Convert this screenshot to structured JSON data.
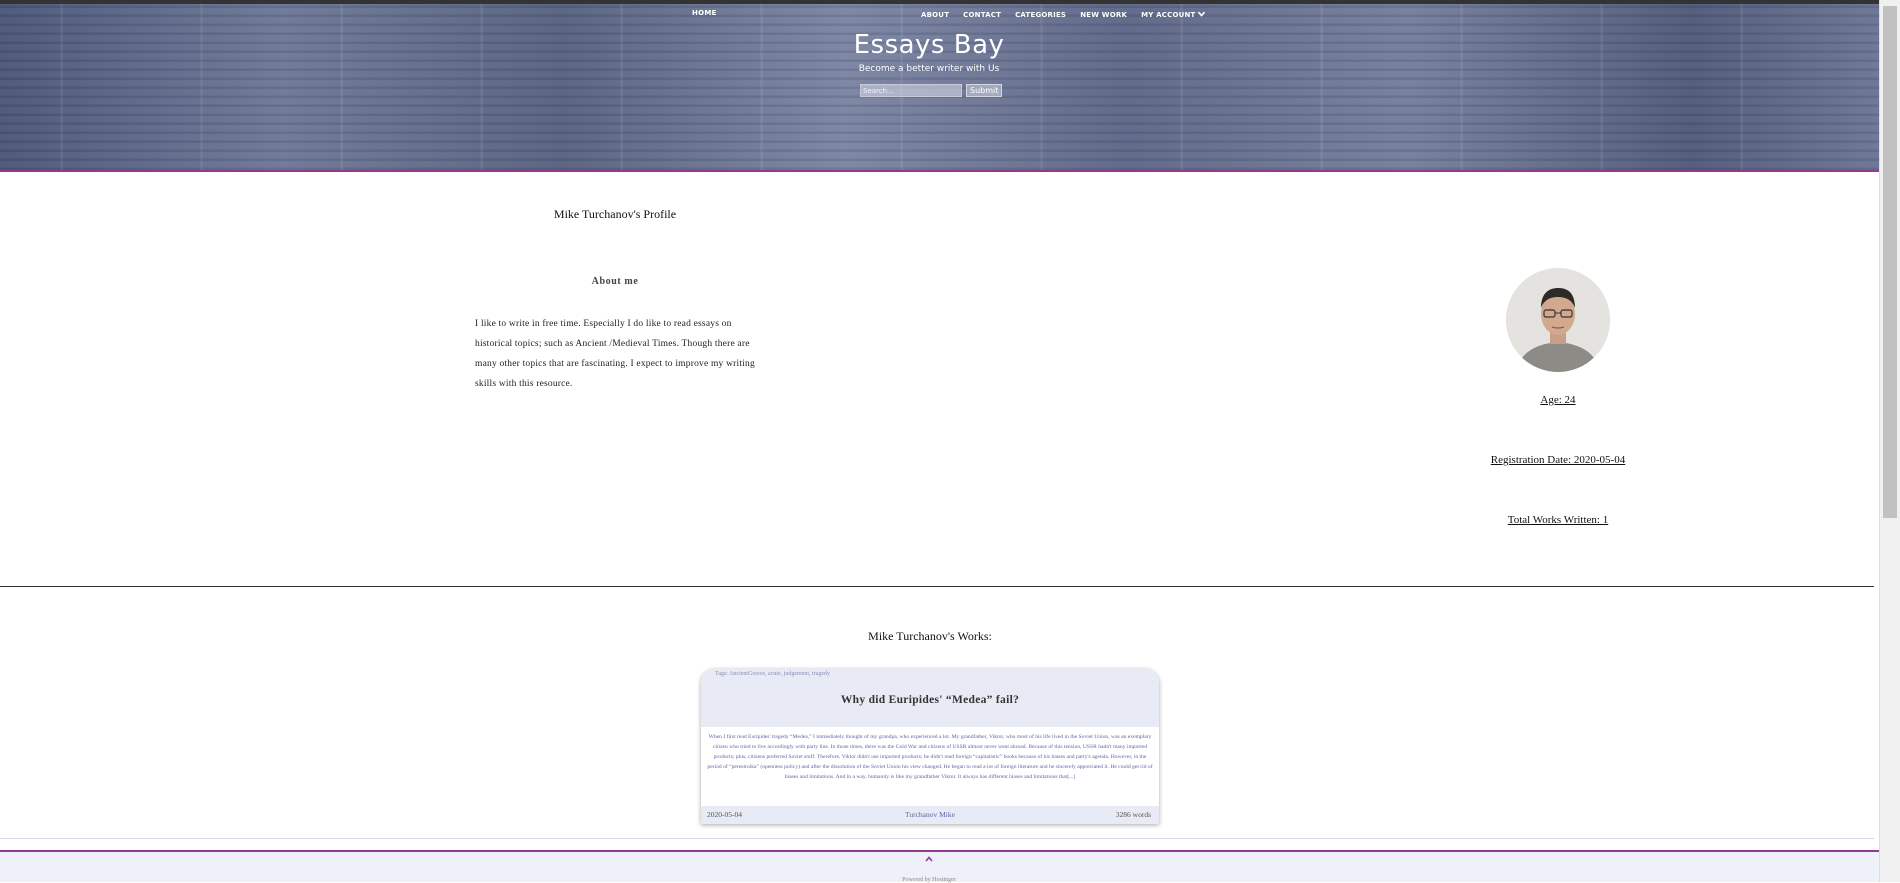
{
  "header": {
    "nav": {
      "home": "HOME",
      "about": "ABOUT",
      "contact": "CONTACT",
      "categories": "CATEGORIES",
      "new_work": "NEW WORK",
      "my_account": "MY ACCOUNT"
    },
    "site_title": "Essays Bay",
    "tagline": "Become a better writer with Us",
    "search": {
      "placeholder": "Search...",
      "value": ""
    },
    "submit_label": "Submit"
  },
  "profile": {
    "title": "Mike Turchanov's Profile",
    "about_heading": "About me",
    "about_text": "I like to write in free time. Especially I do like to read essays on historical topics; such as Ancient /Medieval Times. Though there are many other topics that are fascinating. I expect to improve my writing skills with this resource.",
    "age": "Age: 24",
    "registration_date": "Registration Date: 2020-05-04",
    "total_works": "Total Works Written: 1"
  },
  "works": {
    "title": "Mike Turchanov's Works:",
    "items": [
      {
        "tags": "Tags: AncientGreece, acute, judgement, tragedy",
        "title": "Why did Euripides' “Medea” fail?",
        "excerpt": "When I first read Euripides' tragedy “Medea,” I immediately thought of my grandpa, who experienced a lot. My grandfather, Viktor, who most of his life lived in the Soviet Union, was an exemplary citizen who tried to live accordingly with party line. In those times, there was the Cold War and citizens of USSR almost never went abroad. Because of this tension, USSR hadn't many imported products; plus, citizens preferred Soviet stuff. Therefore, Viktor didn't use imported products; he didn't read foreign “capitalistic” books because of his biases and party's agenda. However, in the period of “perestroika” (openness policy) and after the dissolution of the Soviet Union his view changed. He began to read a lot of foreign literature and he sincerely appreciated it. He could get rid of biases and limitations. And in a way, humanity is like my grandfather Viktor. It always has different biases and limitations that[...]",
        "date": "2020-05-04",
        "author": "Turchanov Mike",
        "words": "3286 words"
      }
    ]
  },
  "footer": {
    "to_top_icon": "chevron-up-icon",
    "credit": "Powered by Hostinger"
  },
  "colors": {
    "accent": "#8e3b91",
    "card_bg": "#e8ebf6",
    "link_text": "#5c67a3"
  }
}
